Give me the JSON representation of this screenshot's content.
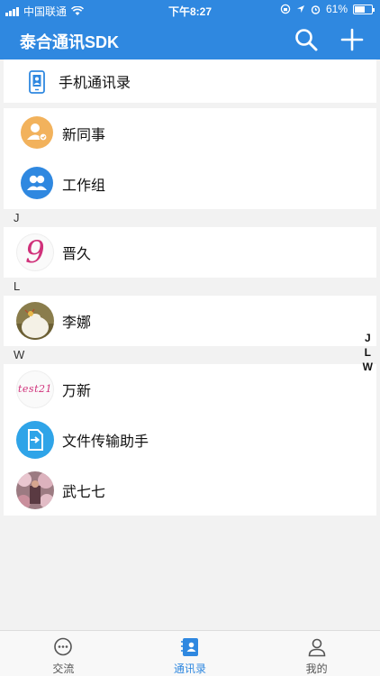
{
  "status_bar": {
    "carrier": "中国联通",
    "time": "下午8:27",
    "battery": "61%",
    "battery_level": 0.61
  },
  "nav": {
    "title": "泰合通讯SDK",
    "icons": [
      "search-icon",
      "plus-icon"
    ]
  },
  "phone_contacts": {
    "label": "手机通讯录",
    "icon": "phone-contacts-icon"
  },
  "special": [
    {
      "label": "新同事",
      "icon": "new-colleague-icon",
      "color": "#f2b25c"
    },
    {
      "label": "工作组",
      "icon": "work-group-icon",
      "color": "#2f88e0"
    }
  ],
  "sections": [
    {
      "letter": "J",
      "contacts": [
        {
          "name": "晋久",
          "avatar": "handwritten-9"
        }
      ]
    },
    {
      "letter": "L",
      "contacts": [
        {
          "name": "李娜",
          "avatar": "photo"
        }
      ]
    },
    {
      "letter": "W",
      "contacts": [
        {
          "name": "万新",
          "avatar": "handwritten-test"
        },
        {
          "name": "文件传输助手",
          "avatar": "file-transfer-icon"
        },
        {
          "name": "武七七",
          "avatar": "photo"
        }
      ]
    }
  ],
  "alpha_index": [
    "J",
    "L",
    "W"
  ],
  "handwritten_avatars": {
    "nine": "9",
    "test": "test21"
  },
  "tabs": [
    {
      "label": "交流",
      "icon": "chat-icon",
      "active": false
    },
    {
      "label": "通讯录",
      "icon": "contacts-icon",
      "active": true
    },
    {
      "label": "我的",
      "icon": "profile-icon",
      "active": false
    }
  ],
  "colors": {
    "primary": "#2f88e0",
    "orange": "#f2b25c",
    "cyan": "#2fa4e8"
  }
}
